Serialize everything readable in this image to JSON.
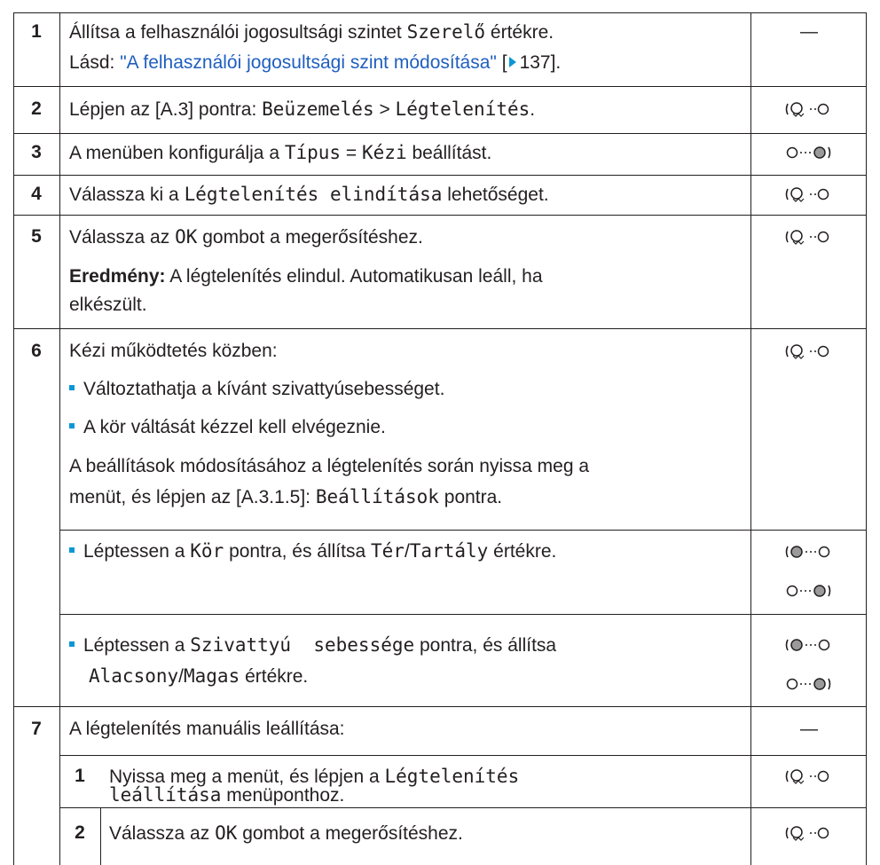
{
  "rows": {
    "r1": {
      "num": "1",
      "line1_a": "Állítsa a felhasználói jogosultsági szintet",
      "line1_mono": "Szerelő",
      "line1_b": "értékre.",
      "line2_a": "Lásd:",
      "line2_link": "\"A felhasználói jogosultsági szint módosítása\"",
      "line2_bracket_open": "[",
      "line2_page": "137].",
      "action": "—"
    },
    "r2": {
      "num": "2",
      "text_a": "Lépjen az [A.3] pontra:",
      "mono1": "Beüzemelés",
      "sep": ">",
      "mono2": "Légtelenítés",
      "end": "."
    },
    "r3": {
      "num": "3",
      "text_a": "A menüben konfigurálja a",
      "mono1": "Típus",
      "eq": "=",
      "mono2": "Kézi",
      "end": "beállítást."
    },
    "r4": {
      "num": "4",
      "text_a": "Válassza ki a",
      "mono1": "Légtelenítés elindítása",
      "end": "lehetőséget."
    },
    "r5": {
      "num": "5",
      "text_a": "Válassza az",
      "mono1": "OK",
      "end": "gombot a megerősítéshez.",
      "result_label": "Eredmény:",
      "result_text1": "A légtelenítés elindul. Automatikusan leáll, ha",
      "result_text2": "elkészült."
    },
    "r6": {
      "num": "6",
      "line1": "Kézi működtetés közben:",
      "bullet1": "Változtathatja a kívánt szivattyúsebességet.",
      "bullet2": "A kör váltását kézzel kell elvégeznie.",
      "para1": "A beállítások módosításához a légtelenítés során nyissa meg a",
      "para2_a": "menüt, és lépjen az [A.3.1.5]:",
      "para2_mono": "Beállítások",
      "para2_b": "pontra.",
      "sub1_a": "Léptessen a",
      "sub1_mono1": "Kör",
      "sub1_b": "pontra, és állítsa",
      "sub1_mono2": "Tér",
      "sub1_slash": "/",
      "sub1_mono3": "Tartály",
      "sub1_c": "értékre.",
      "sub2_a": "Léptessen a",
      "sub2_mono1": "Szivattyú  sebessége",
      "sub2_b": "pontra, és állítsa",
      "sub2_mono2": "Alacsony",
      "sub2_slash": "/",
      "sub2_mono3": "Magas",
      "sub2_c": "értékre."
    },
    "r7": {
      "num": "7",
      "line1": "A légtelenítés manuális leállítása:",
      "action": "—",
      "s1_num": "1",
      "s1_a": "Nyissa meg a menüt, és lépjen a",
      "s1_mono1": "Légtelenítés",
      "s1_mono2": "leállítása",
      "s1_b": "menüponthoz.",
      "s2_num": "2",
      "s2_a": "Válassza az",
      "s2_mono": "OK",
      "s2_b": "gombot a megerősítéshez."
    }
  },
  "icons": {
    "left_dial": "left-dial-turn-icon",
    "right_dial": "right-dial-turn-icon",
    "left_dial_plain": "left-dial-icon"
  },
  "colors": {
    "link": "#1f5fbf",
    "bullet": "#0b97d4",
    "border": "#231f20"
  }
}
